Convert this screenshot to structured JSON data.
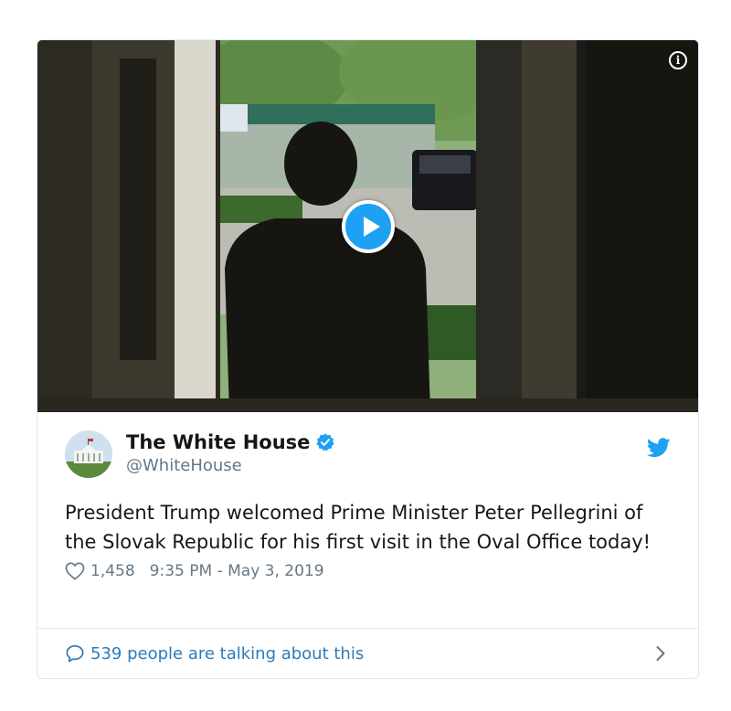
{
  "media": {
    "info_label": "i"
  },
  "author": {
    "display_name": "The White House",
    "handle": "@WhiteHouse",
    "verified": true
  },
  "tweet": {
    "text": "President Trump welcomed Prime Minister Peter Pellegrini of the Slovak Republic for his first visit in the Oval Office today!",
    "likes": "1,458",
    "timestamp": "9:35 PM - May 3, 2019"
  },
  "footer": {
    "talking_label": "539 people are talking about this"
  },
  "colors": {
    "accent": "#1da1f2",
    "link": "#2b7bb9",
    "muted": "#657786",
    "border": "#e1e8ed"
  },
  "icons": {
    "info": "info-icon",
    "play": "play-icon",
    "verified": "verified-badge-icon",
    "bird": "twitter-bird-icon",
    "heart": "heart-icon",
    "reply": "comment-bubble-icon",
    "chevron": "chevron-right-icon"
  }
}
